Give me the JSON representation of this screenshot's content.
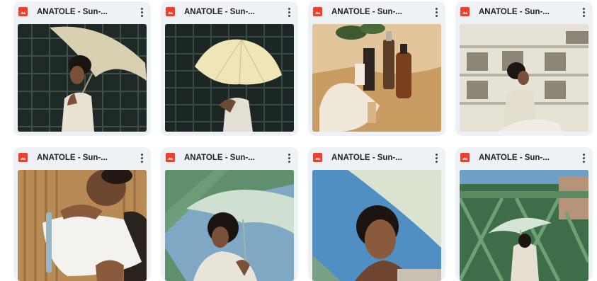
{
  "files": [
    {
      "title": "ANATOLE - Sun-...",
      "icon": "image-file-icon",
      "menu_icon": "more-vert-icon"
    },
    {
      "title": "ANATOLE - Sun-...",
      "icon": "image-file-icon",
      "menu_icon": "more-vert-icon"
    },
    {
      "title": "ANATOLE - Sun-...",
      "icon": "image-file-icon",
      "menu_icon": "more-vert-icon"
    },
    {
      "title": "ANATOLE - Sun-...",
      "icon": "image-file-icon",
      "menu_icon": "more-vert-icon"
    },
    {
      "title": "ANATOLE - Sun-...",
      "icon": "image-file-icon",
      "menu_icon": "more-vert-icon"
    },
    {
      "title": "ANATOLE - Sun-...",
      "icon": "image-file-icon",
      "menu_icon": "more-vert-icon"
    },
    {
      "title": "ANATOLE - Sun-...",
      "icon": "image-file-icon",
      "menu_icon": "more-vert-icon"
    },
    {
      "title": "ANATOLE - Sun-...",
      "icon": "image-file-icon",
      "menu_icon": "more-vert-icon"
    }
  ],
  "colors": {
    "card_bg": "#eef1f5",
    "icon_red": "#e94235",
    "text": "#202124"
  }
}
